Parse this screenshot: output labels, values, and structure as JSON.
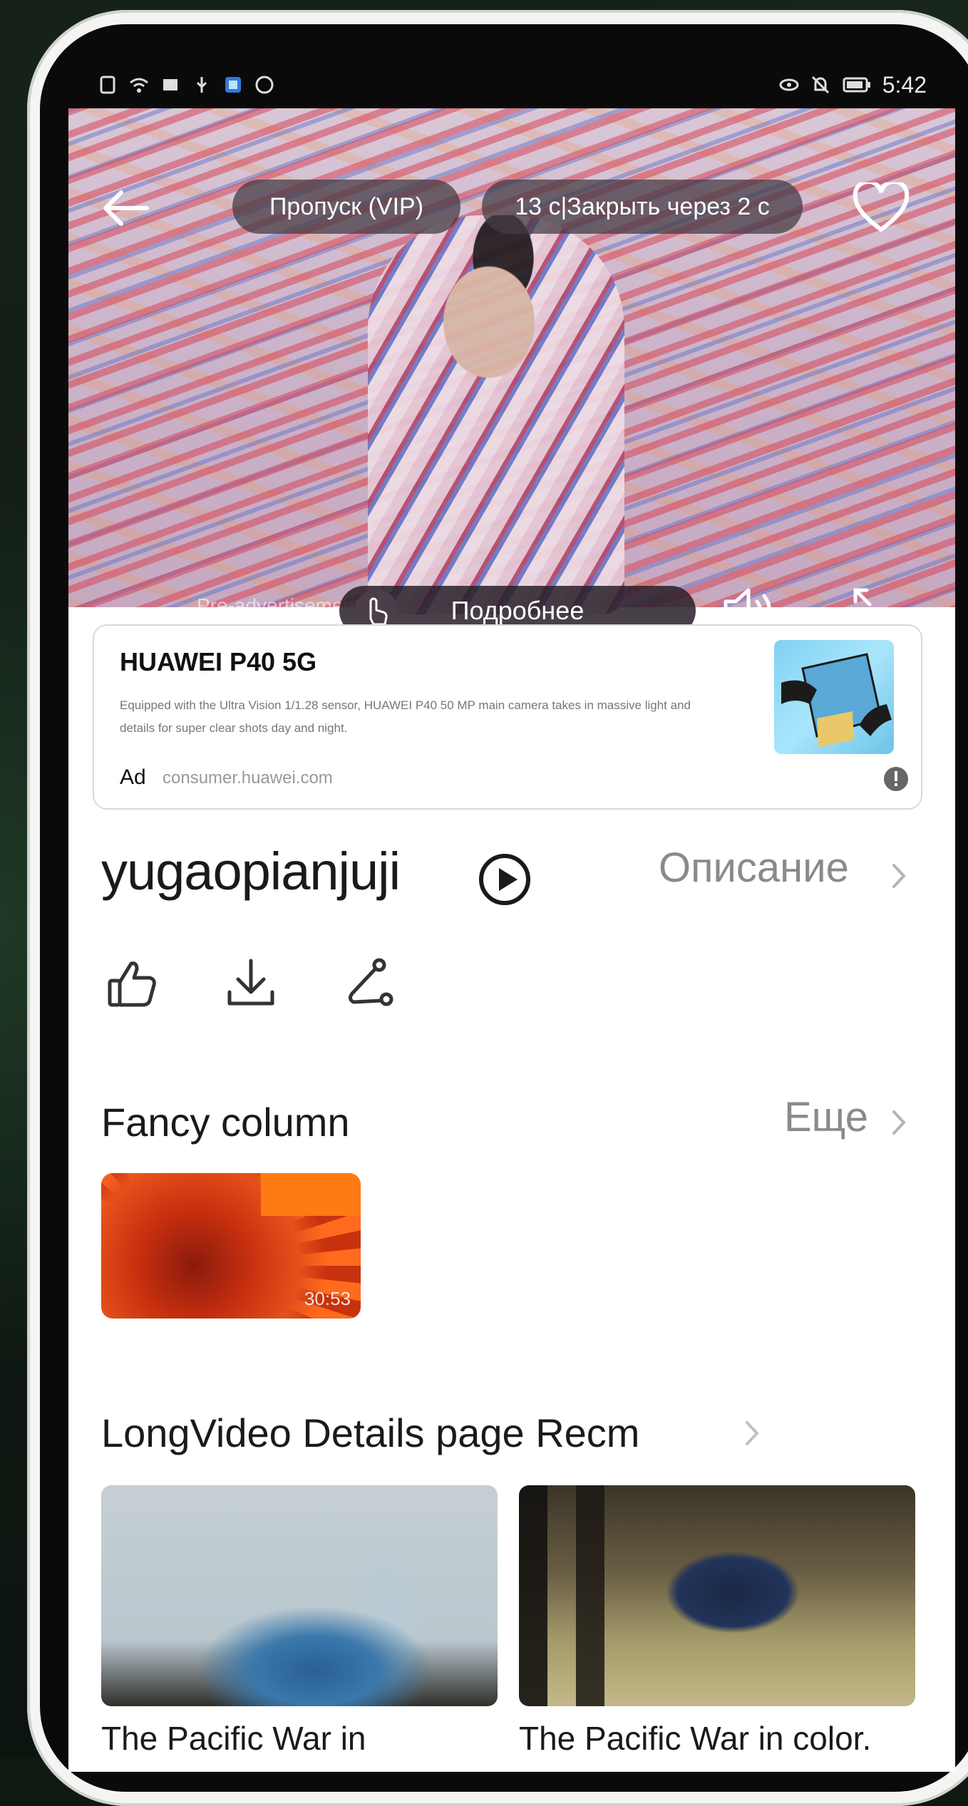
{
  "status_bar": {
    "time": "5:42"
  },
  "player": {
    "skip_label": "Пропуск (VIP)",
    "countdown_label": "13 с|Закрыть через 2 с",
    "pre_ad_label": "Pre-advertisement",
    "details_label": "Подробнее"
  },
  "ad": {
    "title": "HUAWEI P40 5G",
    "description": "Equipped with the Ultra Vision 1/1.28 sensor, HUAWEI P40 50 MP main camera takes in massive light and details for super clear shots day and night.",
    "label": "Ad",
    "domain": "consumer.huawei.com"
  },
  "video": {
    "title": "yugaopianjuji",
    "description_link": "Описание"
  },
  "fancy_column": {
    "heading": "Fancy column",
    "more_link": "Еще",
    "items": [
      {
        "duration": "30:53"
      }
    ]
  },
  "recommendations": {
    "heading": "LongVideo Details page Recm",
    "items": [
      {
        "title": "The Pacific War in"
      },
      {
        "title": "The Pacific War in color."
      }
    ]
  }
}
